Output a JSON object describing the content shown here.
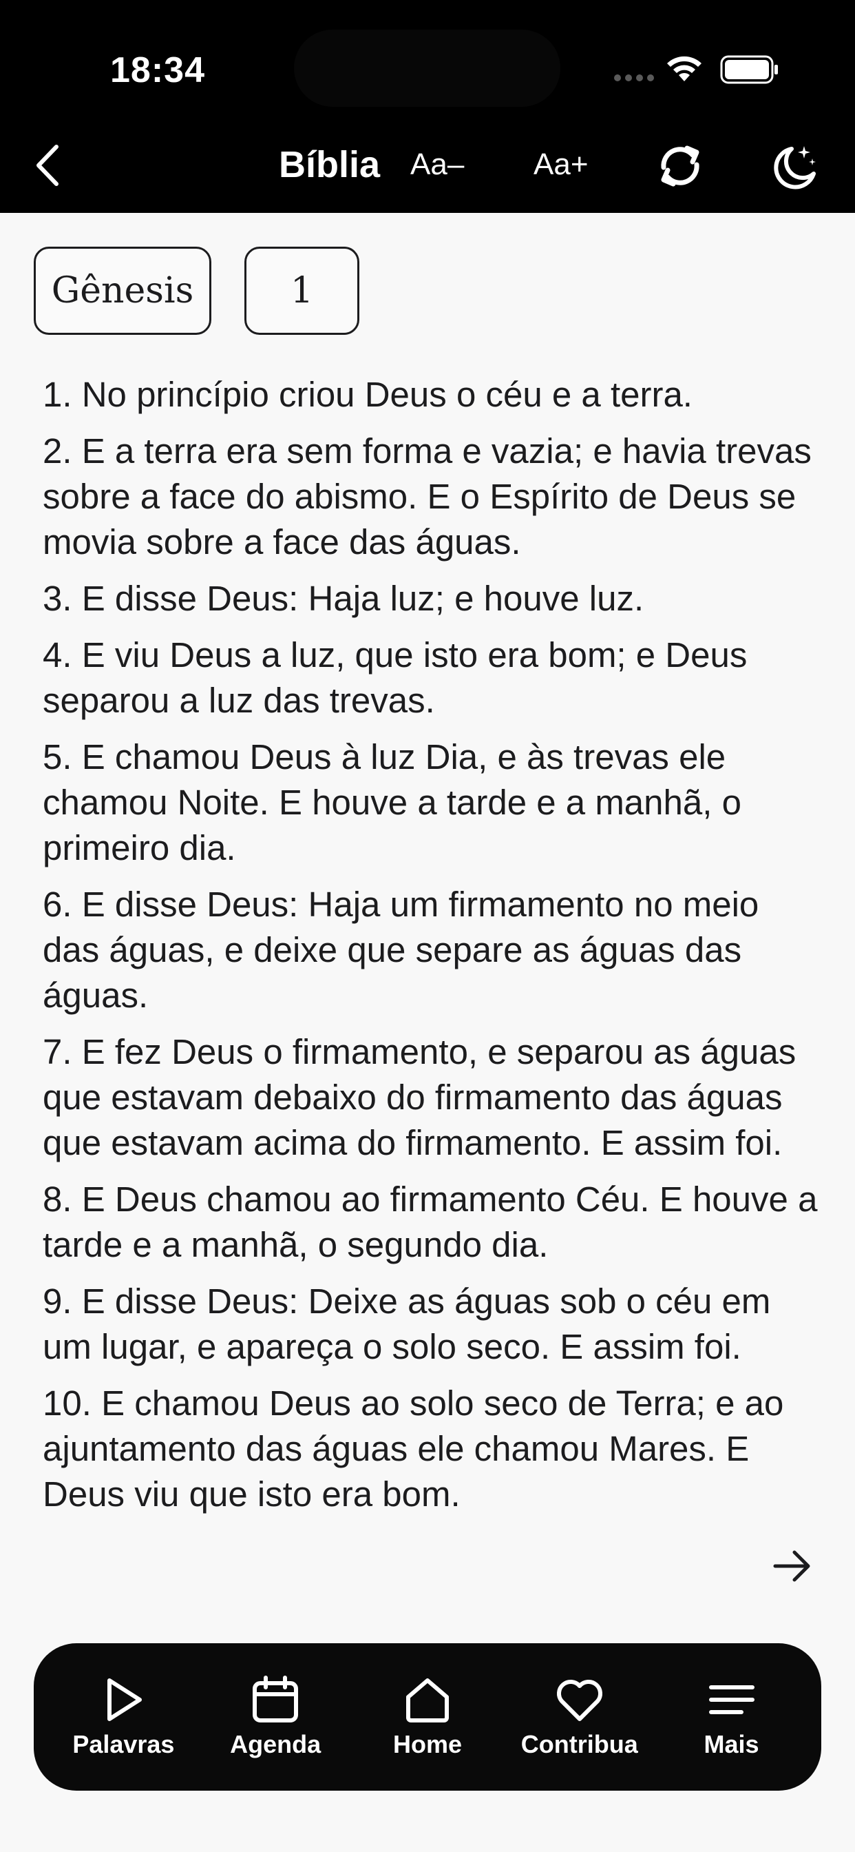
{
  "status_bar": {
    "time": "18:34"
  },
  "header": {
    "back_icon": "chevron-left-icon",
    "title": "Bíblia",
    "font_decrease_label": "Aa–",
    "font_increase_label": "Aa+",
    "refresh_icon": "refresh-icon",
    "theme_icon": "moon-icon"
  },
  "selectors": {
    "book": "Gênesis",
    "chapter": "1"
  },
  "verses": [
    "1. No princípio criou Deus o céu e a terra.",
    "2. E a terra era sem forma e vazia; e havia trevas sobre a face do abismo. E o Espírito de Deus se movia sobre a face das águas.",
    "3. E disse Deus: Haja luz; e houve luz.",
    "4. E viu Deus a luz, que isto era bom; e Deus separou a luz das trevas.",
    "5. E chamou Deus à luz Dia, e às trevas ele chamou Noite. E houve a tarde e a manhã, o primeiro dia.",
    "6. E disse Deus: Haja um firmamento no meio das águas, e deixe que separe as águas das águas.",
    "7. E fez Deus o firmamento, e separou as águas que estavam debaixo do firmamento das águas que estavam acima do firmamento. E assim foi.",
    "8. E Deus chamou ao firmamento Céu. E houve a tarde e a manhã, o segundo dia.",
    "9. E disse Deus: Deixe as águas sob o céu em um lugar, e apareça o solo seco. E assim foi.",
    "10. E chamou Deus ao solo seco de Terra; e ao ajuntamento das águas ele chamou Mares. E Deus viu que isto era bom."
  ],
  "next_icon": "arrow-right-icon",
  "nav": {
    "items": [
      {
        "label": "Palavras",
        "icon": "play-icon"
      },
      {
        "label": "Agenda",
        "icon": "calendar-icon"
      },
      {
        "label": "Home",
        "icon": "home-icon"
      },
      {
        "label": "Contribua",
        "icon": "heart-icon"
      },
      {
        "label": "Mais",
        "icon": "menu-icon"
      }
    ]
  },
  "colors": {
    "header_bg": "#000000",
    "nav_bg": "#0a0a0a",
    "page_bg": "#f8f8f8",
    "text": "#1c1c1e"
  }
}
